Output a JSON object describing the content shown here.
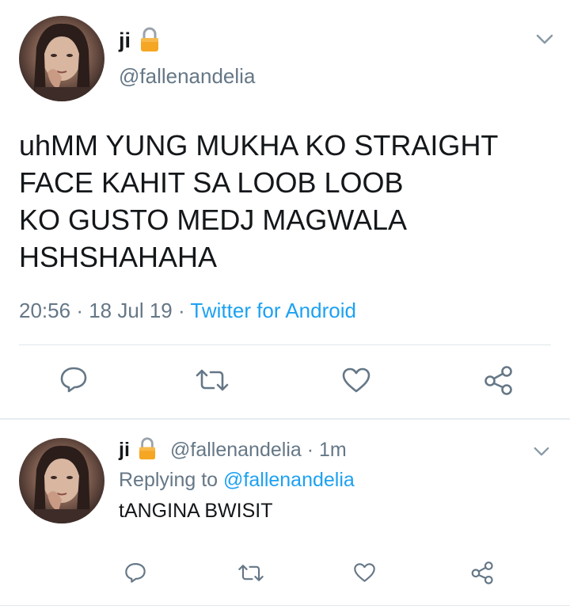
{
  "main_tweet": {
    "author_name": "ji",
    "lock_icon": "lock-icon",
    "handle": "@fallenandelia",
    "text": "uhMM YUNG MUKHA KO STRAIGHT\nFACE KAHIT SA LOOB LOOB\nKO GUSTO MEDJ MAGWALA\nHSHSHAHAHA",
    "time": "20:56",
    "sep1": "·",
    "date": "18 Jul 19",
    "sep2": "·",
    "source": "Twitter for Android"
  },
  "reply": {
    "author_name": "ji",
    "handle": "@fallenandelia",
    "sep": "·",
    "age": "1m",
    "replying_label": "Replying to",
    "replying_handle": "@fallenandelia",
    "text": "tANGINA BWISIT"
  },
  "icons": {
    "reply": "reply-icon",
    "retweet": "retweet-icon",
    "like": "like-icon",
    "share": "share-icon",
    "menu": "chevron-down-icon"
  },
  "colors": {
    "text": "#14171a",
    "muted": "#657786",
    "link": "#1da1f2",
    "lock": "#f5a623",
    "divider": "#e1e8ed"
  }
}
